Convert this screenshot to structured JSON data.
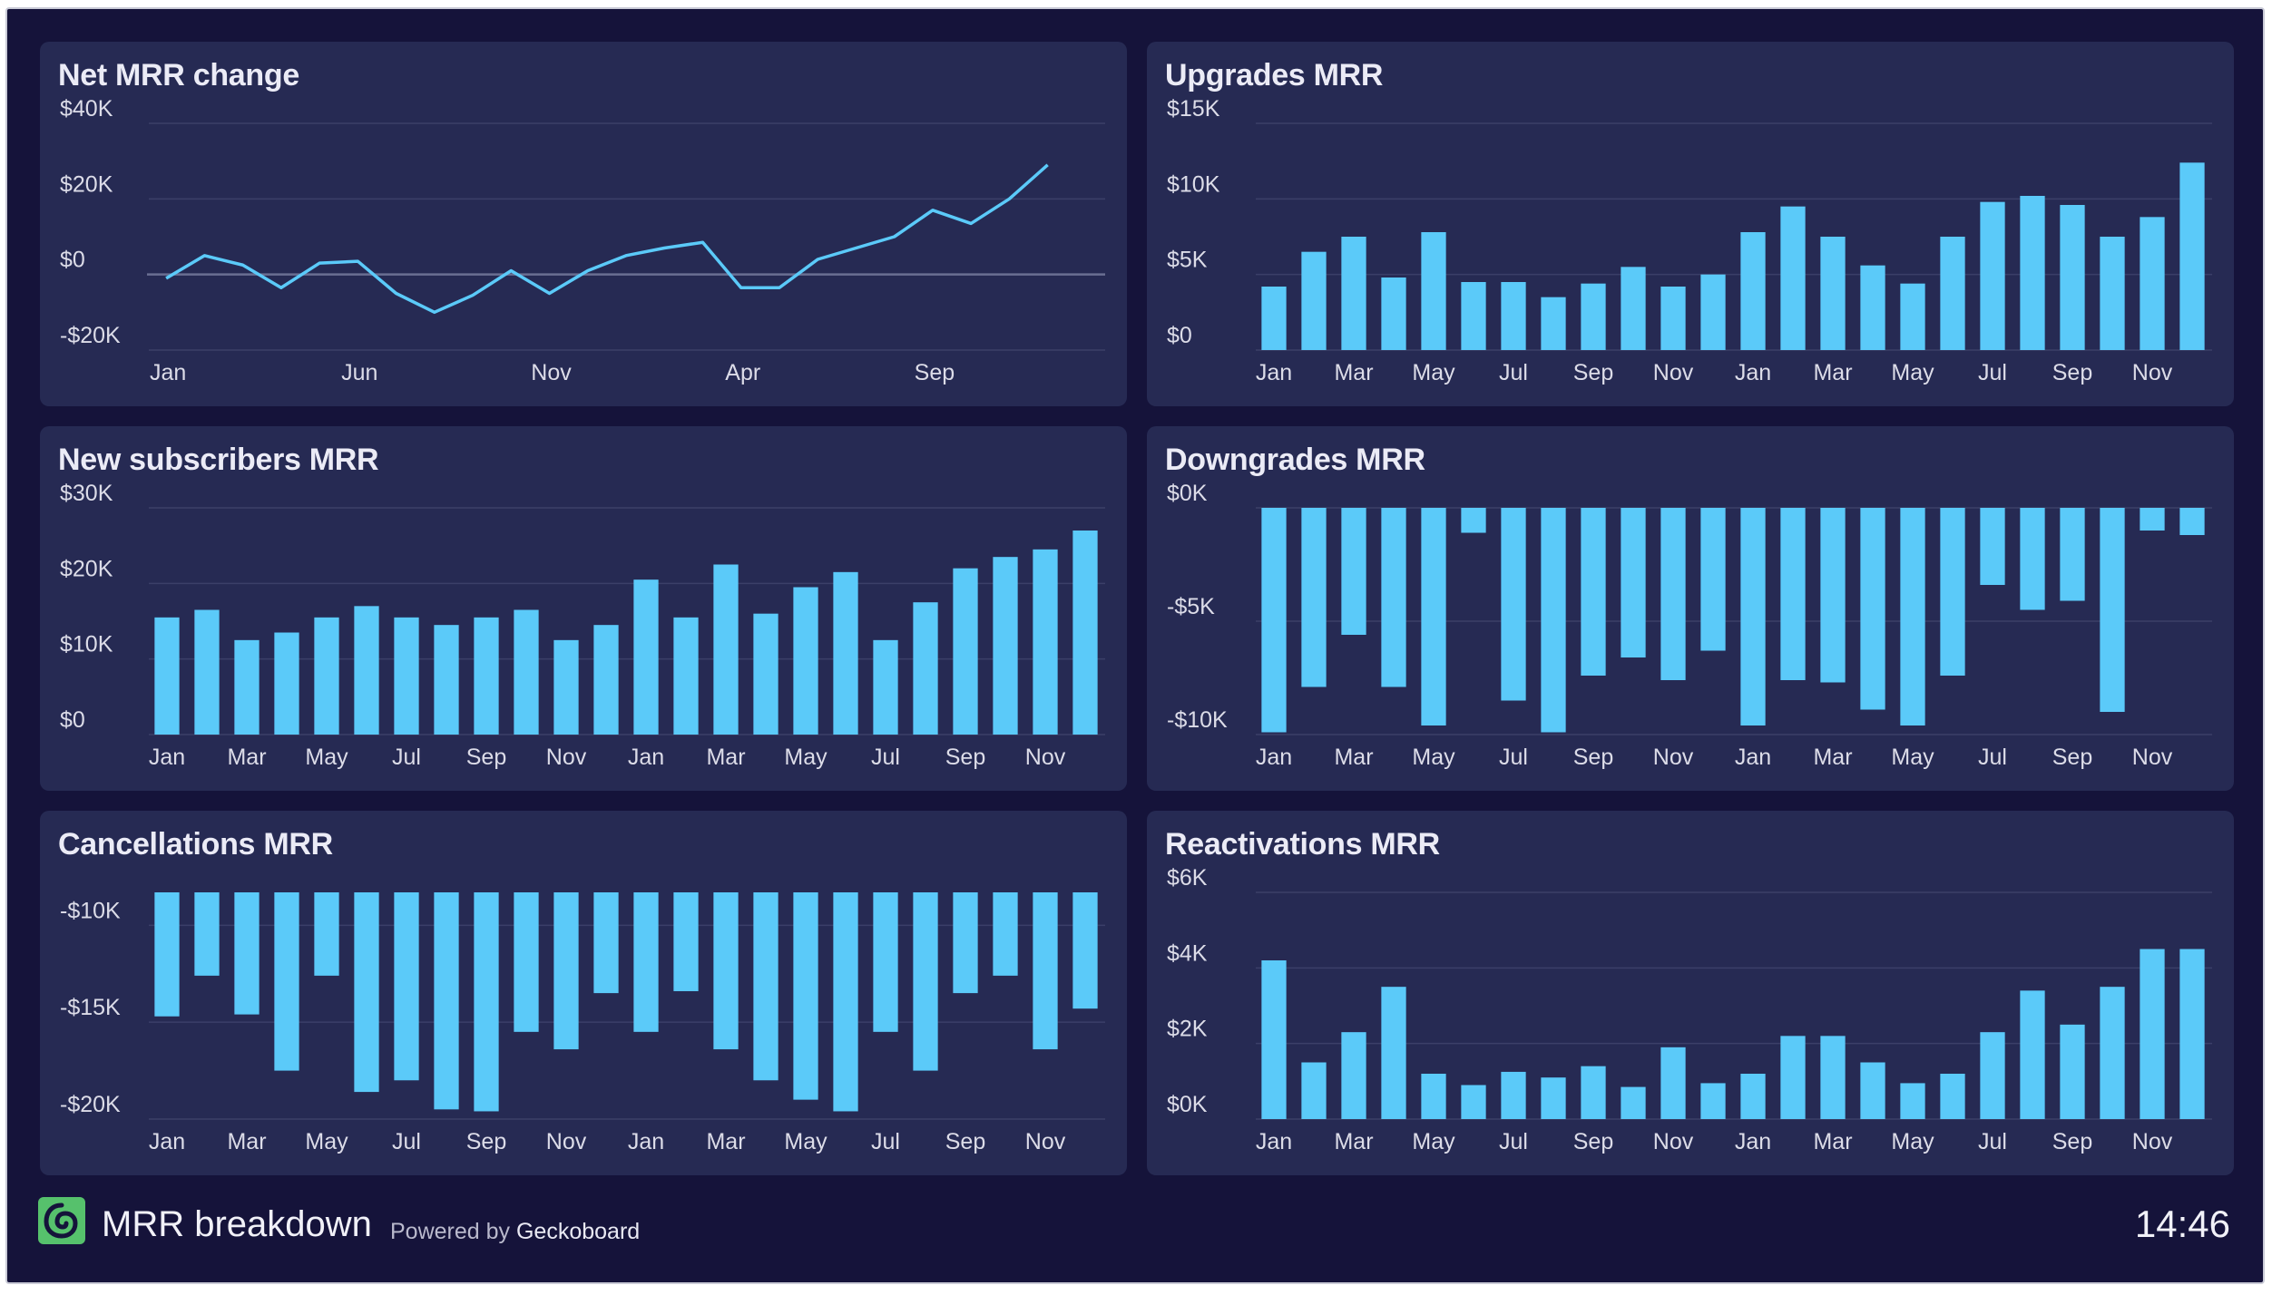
{
  "footer": {
    "title": "MRR breakdown",
    "powered_prefix": "Powered by",
    "powered_brand": "Geckoboard",
    "time": "14:46",
    "logo_icon": "geckoboard-logo-icon"
  },
  "colors": {
    "background": "#15133a",
    "panel": "#262a53",
    "series": "#5bcaf9",
    "grid": "#3b3f68",
    "logo": "#56c16c"
  },
  "panels": [
    {
      "title": "Net MRR change",
      "chart_data": {
        "type": "line",
        "title": "Net MRR change",
        "x_ticks": [
          "Jan",
          "Jun",
          "Nov",
          "Apr",
          "Sep"
        ],
        "x_tick_indices": [
          0,
          5,
          10,
          15,
          20
        ],
        "y_ticks": [
          40000,
          20000,
          0,
          -20000
        ],
        "y_tick_labels": [
          "$40K",
          "$20K",
          "$0",
          "-$20K"
        ],
        "ylim": [
          -20000,
          40000
        ],
        "zero_line": true,
        "values": [
          -1000,
          5000,
          2500,
          -3500,
          3000,
          3500,
          -5000,
          -10000,
          -5500,
          1000,
          -5000,
          1000,
          5000,
          7000,
          8500,
          -3500,
          -3500,
          4000,
          7000,
          10000,
          17000,
          13500,
          20000,
          29000
        ]
      }
    },
    {
      "title": "Upgrades MRR",
      "chart_data": {
        "type": "bar",
        "title": "Upgrades MRR",
        "x_ticks": [
          "Jan",
          "Mar",
          "May",
          "Jul",
          "Sep",
          "Nov",
          "Jan",
          "Mar",
          "May",
          "Jul",
          "Sep",
          "Nov"
        ],
        "x_tick_indices": [
          0,
          2,
          4,
          6,
          8,
          10,
          12,
          14,
          16,
          18,
          20,
          22
        ],
        "y_ticks": [
          15000,
          10000,
          5000,
          0
        ],
        "y_tick_labels": [
          "$15K",
          "$10K",
          "$5K",
          "$0"
        ],
        "ylim": [
          0,
          15000
        ],
        "values": [
          4200,
          6500,
          7500,
          4800,
          7800,
          4500,
          4500,
          3500,
          4400,
          5500,
          4200,
          5000,
          7800,
          9500,
          7500,
          5600,
          4400,
          7500,
          9800,
          10200,
          9600,
          7500,
          8800,
          12400
        ]
      }
    },
    {
      "title": "New subscribers MRR",
      "chart_data": {
        "type": "bar",
        "title": "New subscribers MRR",
        "x_ticks": [
          "Jan",
          "Mar",
          "May",
          "Jul",
          "Sep",
          "Nov",
          "Jan",
          "Mar",
          "May",
          "Jul",
          "Sep",
          "Nov"
        ],
        "x_tick_indices": [
          0,
          2,
          4,
          6,
          8,
          10,
          12,
          14,
          16,
          18,
          20,
          22
        ],
        "y_ticks": [
          30000,
          20000,
          10000,
          0
        ],
        "y_tick_labels": [
          "$30K",
          "$20K",
          "$10K",
          "$0"
        ],
        "ylim": [
          0,
          30000
        ],
        "values": [
          15500,
          16500,
          12500,
          13500,
          15500,
          17000,
          15500,
          14500,
          15500,
          16500,
          12500,
          14500,
          20500,
          15500,
          22500,
          16000,
          19500,
          21500,
          12500,
          17500,
          22000,
          23500,
          24500,
          27000
        ]
      }
    },
    {
      "title": "Downgrades MRR",
      "chart_data": {
        "type": "bar",
        "title": "Downgrades MRR",
        "x_ticks": [
          "Jan",
          "Mar",
          "May",
          "Jul",
          "Sep",
          "Nov",
          "Jan",
          "Mar",
          "May",
          "Jul",
          "Sep",
          "Nov"
        ],
        "x_tick_indices": [
          0,
          2,
          4,
          6,
          8,
          10,
          12,
          14,
          16,
          18,
          20,
          22
        ],
        "y_ticks": [
          0,
          -5000,
          -10000
        ],
        "y_tick_labels": [
          "$0K",
          "-$5K",
          "-$10K"
        ],
        "ylim": [
          -10000,
          0
        ],
        "values": [
          -9900,
          -7900,
          -5600,
          -7900,
          -9600,
          -1100,
          -8500,
          -9900,
          -7400,
          -6600,
          -7600,
          -6300,
          -9600,
          -7600,
          -7700,
          -8900,
          -9600,
          -7400,
          -3400,
          -4500,
          -4100,
          -9000,
          -1000,
          -1200
        ]
      }
    },
    {
      "title": "Cancellations MRR",
      "chart_data": {
        "type": "bar",
        "title": "Cancellations MRR",
        "x_ticks": [
          "Jan",
          "Mar",
          "May",
          "Jul",
          "Sep",
          "Nov",
          "Jan",
          "Mar",
          "May",
          "Jul",
          "Sep",
          "Nov"
        ],
        "x_tick_indices": [
          0,
          2,
          4,
          6,
          8,
          10,
          12,
          14,
          16,
          18,
          20,
          22
        ],
        "y_ticks": [
          -10000,
          -15000,
          -20000
        ],
        "y_tick_labels": [
          "-$10K",
          "-$15K",
          "-$20K"
        ],
        "ylim": [
          -20000,
          -8300
        ],
        "values": [
          -14700,
          -12600,
          -14600,
          -17500,
          -12600,
          -18600,
          -18000,
          -19500,
          -19600,
          -15500,
          -16400,
          -13500,
          -15500,
          -13400,
          -16400,
          -18000,
          -19000,
          -19600,
          -15500,
          -17500,
          -13500,
          -12600,
          -16400,
          -14300
        ]
      }
    },
    {
      "title": "Reactivations MRR",
      "chart_data": {
        "type": "bar",
        "title": "Reactivations MRR",
        "x_ticks": [
          "Jan",
          "Mar",
          "May",
          "Jul",
          "Sep",
          "Nov",
          "Jan",
          "Mar",
          "May",
          "Jul",
          "Sep",
          "Nov"
        ],
        "x_tick_indices": [
          0,
          2,
          4,
          6,
          8,
          10,
          12,
          14,
          16,
          18,
          20,
          22
        ],
        "y_ticks": [
          6000,
          4000,
          2000,
          0
        ],
        "y_tick_labels": [
          "$6K",
          "$4K",
          "$2K",
          "$0K"
        ],
        "ylim": [
          0,
          6000
        ],
        "values": [
          4200,
          1500,
          2300,
          3500,
          1200,
          900,
          1250,
          1100,
          1400,
          850,
          1900,
          950,
          1200,
          2200,
          2200,
          1500,
          950,
          1200,
          2300,
          3400,
          2500,
          3500,
          4500,
          4500
        ]
      }
    }
  ]
}
